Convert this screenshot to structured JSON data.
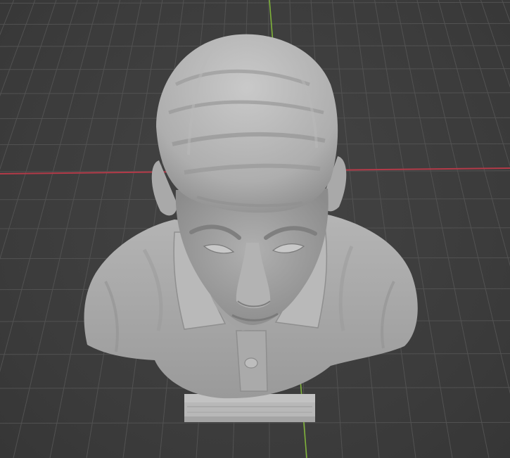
{
  "app": {
    "name": "3D viewport"
  },
  "viewport": {
    "background_color": "#3d3d3d",
    "grid_color": "#525252",
    "x_axis_color": "#b33a48",
    "y_axis_color": "#7fb23a",
    "mesh_color": "#a9a9a9",
    "object": "bust-sculpt"
  }
}
